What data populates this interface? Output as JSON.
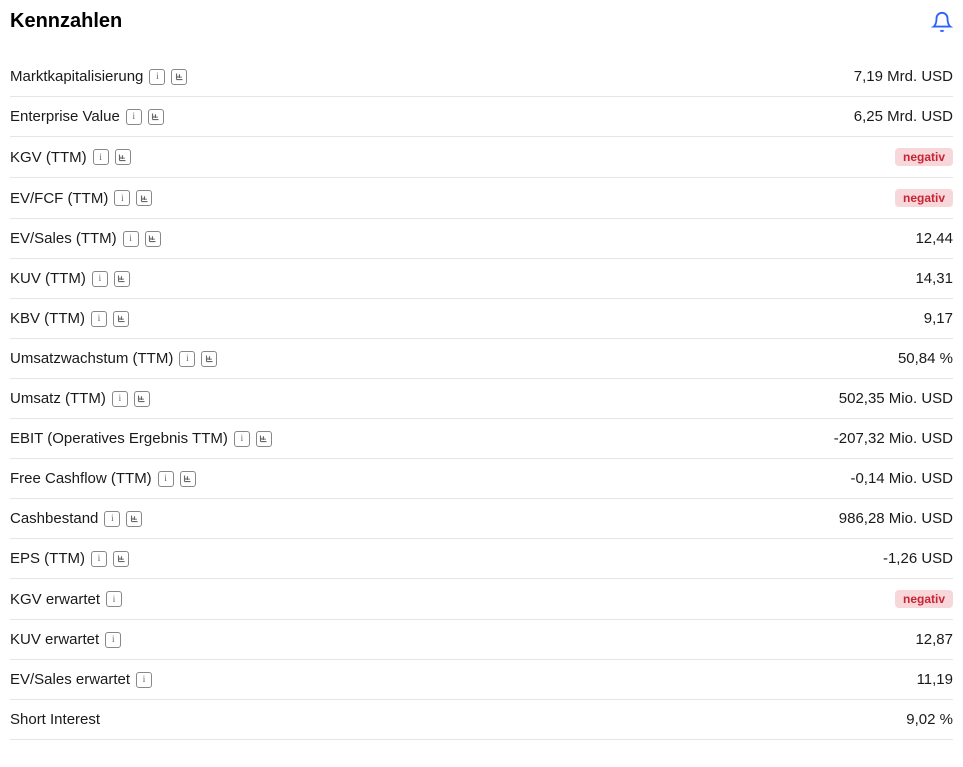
{
  "title": "Kennzahlen",
  "badge_negative": "negativ",
  "rows": [
    {
      "label": "Marktkapitalisierung",
      "value": "7,19 Mrd. USD",
      "info": true,
      "chart": true
    },
    {
      "label": "Enterprise Value",
      "value": "6,25 Mrd. USD",
      "info": true,
      "chart": true
    },
    {
      "label": "KGV (TTM)",
      "value": null,
      "negative": true,
      "info": true,
      "chart": true
    },
    {
      "label": "EV/FCF (TTM)",
      "value": null,
      "negative": true,
      "info": true,
      "chart": true
    },
    {
      "label": "EV/Sales (TTM)",
      "value": "12,44",
      "info": true,
      "chart": true
    },
    {
      "label": "KUV (TTM)",
      "value": "14,31",
      "info": true,
      "chart": true
    },
    {
      "label": "KBV (TTM)",
      "value": "9,17",
      "info": true,
      "chart": true
    },
    {
      "label": "Umsatzwachstum (TTM)",
      "value": "50,84 %",
      "info": true,
      "chart": true
    },
    {
      "label": "Umsatz (TTM)",
      "value": "502,35 Mio. USD",
      "info": true,
      "chart": true
    },
    {
      "label": "EBIT (Operatives Ergebnis TTM)",
      "value": "-207,32 Mio. USD",
      "info": true,
      "chart": true
    },
    {
      "label": "Free Cashflow (TTM)",
      "value": "-0,14 Mio. USD",
      "info": true,
      "chart": true
    },
    {
      "label": "Cashbestand",
      "value": "986,28 Mio. USD",
      "info": true,
      "chart": true
    },
    {
      "label": "EPS (TTM)",
      "value": "-1,26 USD",
      "info": true,
      "chart": true
    },
    {
      "label": "KGV erwartet",
      "value": null,
      "negative": true,
      "info": true,
      "chart": false
    },
    {
      "label": "KUV erwartet",
      "value": "12,87",
      "info": true,
      "chart": false
    },
    {
      "label": "EV/Sales erwartet",
      "value": "11,19",
      "info": true,
      "chart": false
    },
    {
      "label": "Short Interest",
      "value": "9,02 %",
      "info": false,
      "chart": false
    }
  ]
}
